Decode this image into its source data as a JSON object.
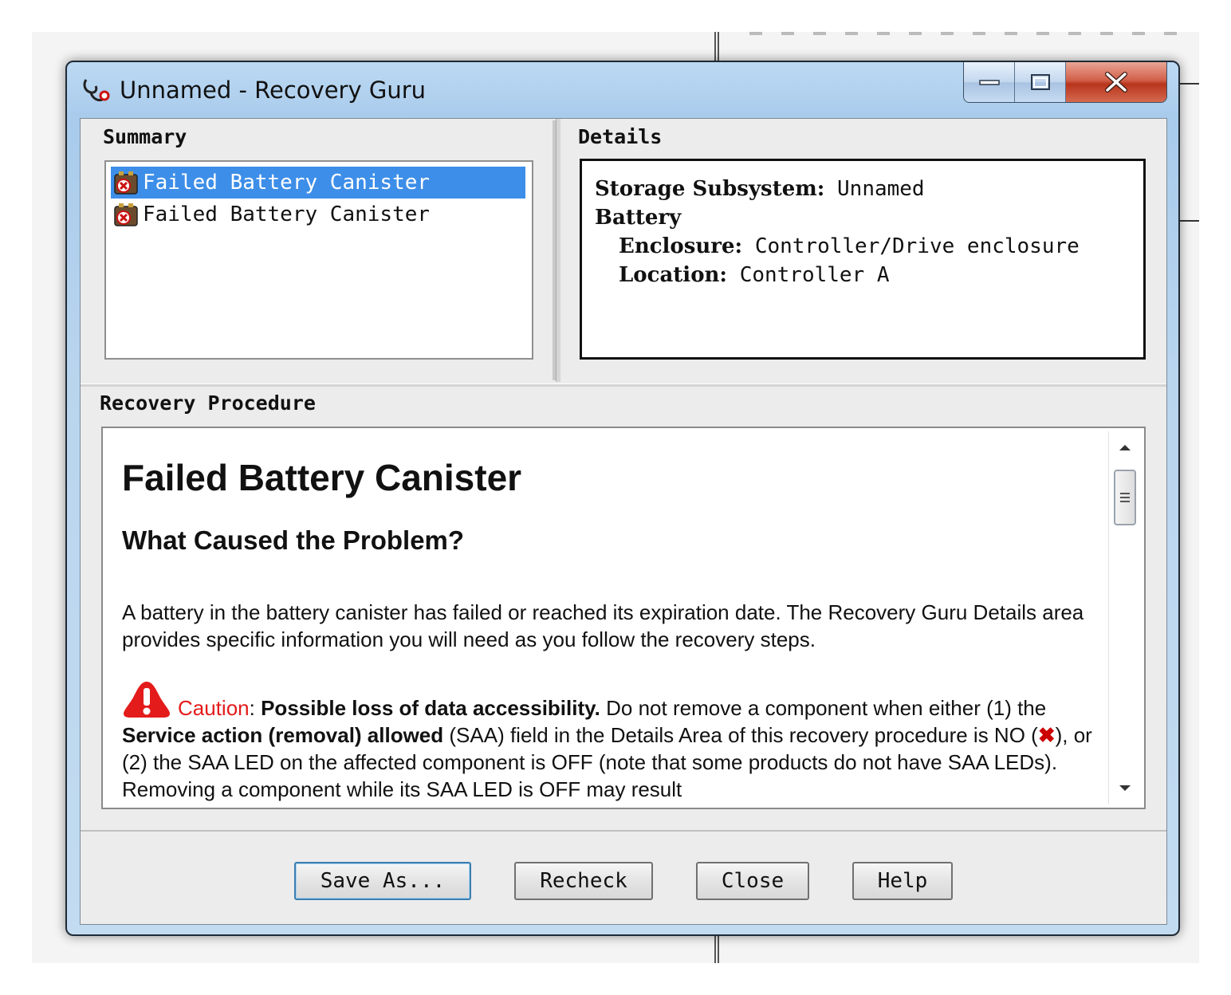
{
  "window": {
    "title": "Unnamed - Recovery Guru",
    "caption_buttons": {
      "minimize": "minimize-icon",
      "maximize": "maximize-icon",
      "close": "close-icon"
    }
  },
  "summary": {
    "heading": "Summary",
    "items": [
      {
        "label": "Failed Battery Canister",
        "selected": true,
        "icon": "failed-battery-icon"
      },
      {
        "label": "Failed Battery Canister",
        "selected": false,
        "icon": "failed-battery-icon"
      }
    ]
  },
  "details": {
    "heading": "Details",
    "subsystem_label": "Storage Subsystem:",
    "subsystem_value": "Unnamed",
    "battery_label": "Battery",
    "enclosure_label": "Enclosure:",
    "enclosure_value": "Controller/Drive enclosure",
    "location_label": "Location:",
    "location_value": "Controller A"
  },
  "procedure": {
    "heading": "Recovery Procedure",
    "title": "Failed Battery Canister",
    "subtitle": "What Caused the Problem?",
    "paragraph": "A battery in the battery canister has failed or reached its expiration date. The Recovery Guru Details area provides specific information you will need as you follow the recovery steps.",
    "caution_word": "Caution",
    "caution_colon": ":",
    "caution_bold": "Possible loss of data accessibility.",
    "caution_text_1": "Do not remove a component when either (1) the",
    "caution_bold_2": "Service action (removal) allowed",
    "caution_text_2": "(SAA) field in the Details Area of this recovery procedure is NO (",
    "caution_x": "✖",
    "caution_text_3": "), or (2) the SAA LED on the affected component is OFF (note that some products do not have SAA LEDs). Removing a component while its SAA LED is OFF may result"
  },
  "buttons": {
    "save_as": "Save As...",
    "recheck": "Recheck",
    "close": "Close",
    "help": "Help"
  },
  "colors": {
    "selection": "#3d8ee8",
    "caution_red": "#e41b1b",
    "window_frame": "#a9cbec"
  }
}
